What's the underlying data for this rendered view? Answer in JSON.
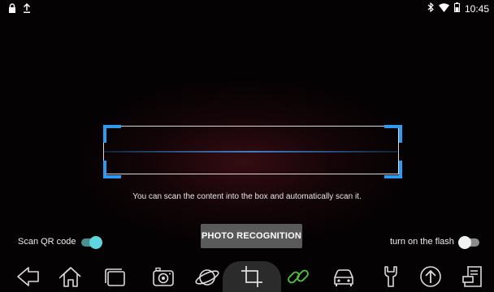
{
  "status_bar": {
    "time": "10:45",
    "left_icons": [
      "lock-icon",
      "upload-icon"
    ],
    "right_icons": [
      "bluetooth-icon",
      "wifi-icon",
      "battery-icon"
    ]
  },
  "scanner": {
    "hint": "You can scan the content into the box and automatically scan it.",
    "accent_color": "#2c9bf0"
  },
  "controls": {
    "scan_qr_label": "Scan QR code",
    "scan_qr_on": true,
    "photo_button_label": "PHOTO RECOGNITION",
    "flash_label": "turn on the flash",
    "flash_on": false
  },
  "nav_bar": {
    "items": [
      "back-icon",
      "home-icon",
      "recent-apps-icon",
      "camera-icon",
      "browser-icon",
      "crop-icon",
      "link-icon",
      "car-icon",
      "wrench-icon",
      "upload-circle-icon",
      "report-icon"
    ],
    "active": "crop-icon"
  }
}
